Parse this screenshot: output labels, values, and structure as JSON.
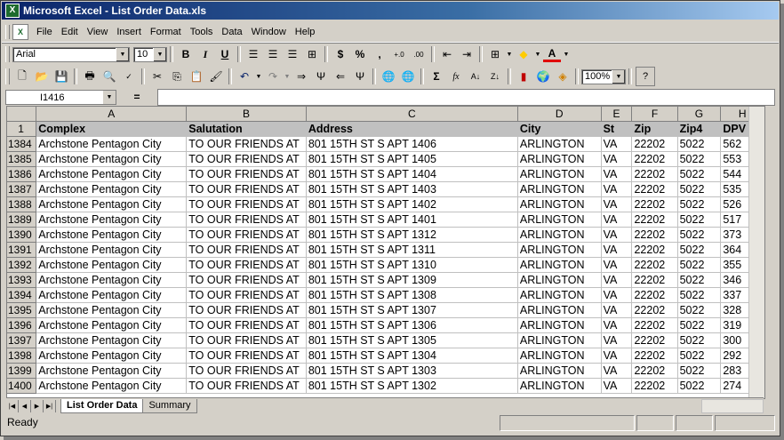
{
  "window": {
    "title": "Microsoft Excel - List Order Data.xls",
    "app_icon": "X"
  },
  "menu": [
    "File",
    "Edit",
    "View",
    "Insert",
    "Format",
    "Tools",
    "Data",
    "Window",
    "Help"
  ],
  "format_toolbar": {
    "font": "Arial",
    "size": "10",
    "bold": "B",
    "italic": "I",
    "underline": "U",
    "currency": "$",
    "percent": "%",
    "comma": ","
  },
  "standard_toolbar": {
    "zoom": "100%",
    "sigma": "Σ",
    "fx": "fx"
  },
  "formula_bar": {
    "name_box": "I1416",
    "equals": "=",
    "value": ""
  },
  "columns": [
    "A",
    "B",
    "C",
    "D",
    "E",
    "F",
    "G",
    "H"
  ],
  "header_row": {
    "num": "1",
    "cells": [
      "Complex",
      "Salutation",
      "Address",
      "City",
      "St",
      "Zip",
      "Zip4",
      "DPV"
    ]
  },
  "rows": [
    {
      "num": "1384",
      "cells": [
        "Archstone Pentagon City",
        "TO OUR FRIENDS AT",
        "801  15TH ST S APT 1406",
        "ARLINGTON",
        "VA",
        "22202",
        "5022",
        "562"
      ]
    },
    {
      "num": "1385",
      "cells": [
        "Archstone Pentagon City",
        "TO OUR FRIENDS AT",
        "801  15TH ST S APT 1405",
        "ARLINGTON",
        "VA",
        "22202",
        "5022",
        "553"
      ]
    },
    {
      "num": "1386",
      "cells": [
        "Archstone Pentagon City",
        "TO OUR FRIENDS AT",
        "801  15TH ST S APT 1404",
        "ARLINGTON",
        "VA",
        "22202",
        "5022",
        "544"
      ]
    },
    {
      "num": "1387",
      "cells": [
        "Archstone Pentagon City",
        "TO OUR FRIENDS AT",
        "801  15TH ST S APT 1403",
        "ARLINGTON",
        "VA",
        "22202",
        "5022",
        "535"
      ]
    },
    {
      "num": "1388",
      "cells": [
        "Archstone Pentagon City",
        "TO OUR FRIENDS AT",
        "801  15TH ST S APT 1402",
        "ARLINGTON",
        "VA",
        "22202",
        "5022",
        "526"
      ]
    },
    {
      "num": "1389",
      "cells": [
        "Archstone Pentagon City",
        "TO OUR FRIENDS AT",
        "801  15TH ST S APT 1401",
        "ARLINGTON",
        "VA",
        "22202",
        "5022",
        "517"
      ]
    },
    {
      "num": "1390",
      "cells": [
        "Archstone Pentagon City",
        "TO OUR FRIENDS AT",
        "801  15TH ST S APT 1312",
        "ARLINGTON",
        "VA",
        "22202",
        "5022",
        "373"
      ]
    },
    {
      "num": "1391",
      "cells": [
        "Archstone Pentagon City",
        "TO OUR FRIENDS AT",
        "801  15TH ST S APT 1311",
        "ARLINGTON",
        "VA",
        "22202",
        "5022",
        "364"
      ]
    },
    {
      "num": "1392",
      "cells": [
        "Archstone Pentagon City",
        "TO OUR FRIENDS AT",
        "801  15TH ST S APT 1310",
        "ARLINGTON",
        "VA",
        "22202",
        "5022",
        "355"
      ]
    },
    {
      "num": "1393",
      "cells": [
        "Archstone Pentagon City",
        "TO OUR FRIENDS AT",
        "801  15TH ST S APT 1309",
        "ARLINGTON",
        "VA",
        "22202",
        "5022",
        "346"
      ]
    },
    {
      "num": "1394",
      "cells": [
        "Archstone Pentagon City",
        "TO OUR FRIENDS AT",
        "801  15TH ST S APT 1308",
        "ARLINGTON",
        "VA",
        "22202",
        "5022",
        "337"
      ]
    },
    {
      "num": "1395",
      "cells": [
        "Archstone Pentagon City",
        "TO OUR FRIENDS AT",
        "801  15TH ST S APT 1307",
        "ARLINGTON",
        "VA",
        "22202",
        "5022",
        "328"
      ]
    },
    {
      "num": "1396",
      "cells": [
        "Archstone Pentagon City",
        "TO OUR FRIENDS AT",
        "801  15TH ST S APT 1306",
        "ARLINGTON",
        "VA",
        "22202",
        "5022",
        "319"
      ]
    },
    {
      "num": "1397",
      "cells": [
        "Archstone Pentagon City",
        "TO OUR FRIENDS AT",
        "801  15TH ST S APT 1305",
        "ARLINGTON",
        "VA",
        "22202",
        "5022",
        "300"
      ]
    },
    {
      "num": "1398",
      "cells": [
        "Archstone Pentagon City",
        "TO OUR FRIENDS AT",
        "801  15TH ST S APT 1304",
        "ARLINGTON",
        "VA",
        "22202",
        "5022",
        "292"
      ]
    },
    {
      "num": "1399",
      "cells": [
        "Archstone Pentagon City",
        "TO OUR FRIENDS AT",
        "801  15TH ST S APT 1303",
        "ARLINGTON",
        "VA",
        "22202",
        "5022",
        "283"
      ]
    },
    {
      "num": "1400",
      "cells": [
        "Archstone Pentagon City",
        "TO OUR FRIENDS AT",
        "801  15TH ST S APT 1302",
        "ARLINGTON",
        "VA",
        "22202",
        "5022",
        "274"
      ]
    }
  ],
  "sheet_tabs": [
    "List Order Data",
    "Summary"
  ],
  "status": "Ready"
}
